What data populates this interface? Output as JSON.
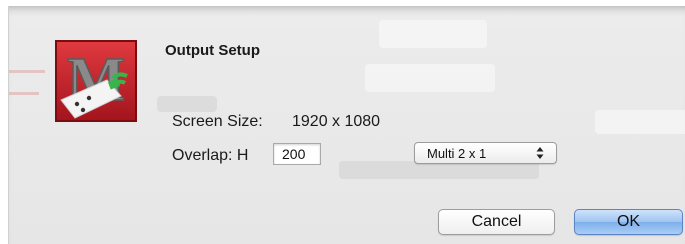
{
  "dialog": {
    "title": "Output Setup",
    "screen_size_label": "Screen Size:",
    "screen_size_value": "1920 x 1080",
    "overlap_label": "Overlap: H",
    "overlap_value": "200",
    "layout_selected": "Multi 2 x 1",
    "cancel_label": "Cancel",
    "ok_label": "OK"
  },
  "icons": {
    "app_icon": "app-logo-icon",
    "popup_arrows": "updown-arrows-icon"
  },
  "colors": {
    "accent_button": "#9fc4f1",
    "app_icon_red": "#c8202a",
    "app_icon_green": "#38b54a"
  }
}
